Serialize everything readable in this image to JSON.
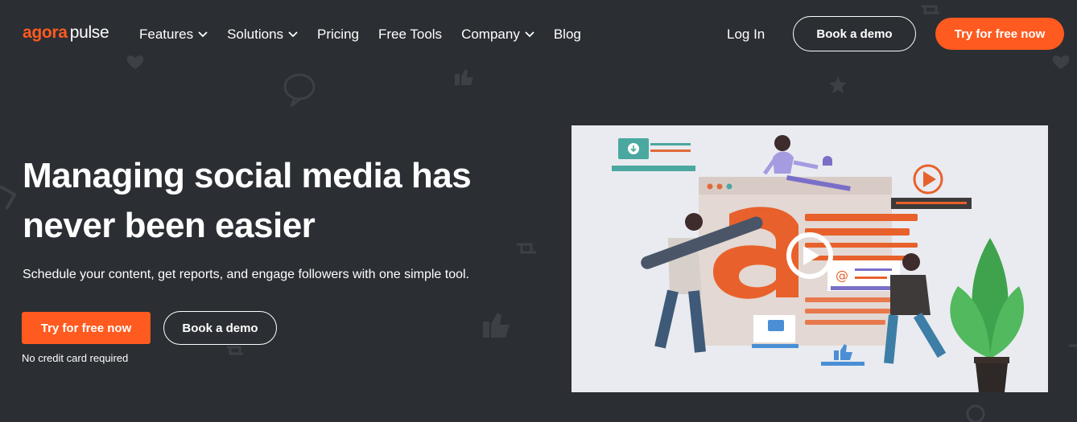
{
  "header": {
    "logo": {
      "part1": "agora",
      "part2": "pulse"
    },
    "nav": [
      {
        "label": "Features",
        "dropdown": true
      },
      {
        "label": "Solutions",
        "dropdown": true
      },
      {
        "label": "Pricing",
        "dropdown": false
      },
      {
        "label": "Free Tools",
        "dropdown": false
      },
      {
        "label": "Company",
        "dropdown": true
      },
      {
        "label": "Blog",
        "dropdown": false
      }
    ],
    "login_label": "Log In",
    "demo_label": "Book a demo",
    "try_label": "Try for free now"
  },
  "hero": {
    "headline": "Managing social media has never been easier",
    "subline": "Schedule your content, get reports, and engage followers with one simple tool.",
    "try_label": "Try for free now",
    "demo_label": "Book a demo",
    "note": "No credit card required"
  },
  "colors": {
    "background": "#2b2e33",
    "accent": "#ff5a1f",
    "text": "#ffffff"
  }
}
